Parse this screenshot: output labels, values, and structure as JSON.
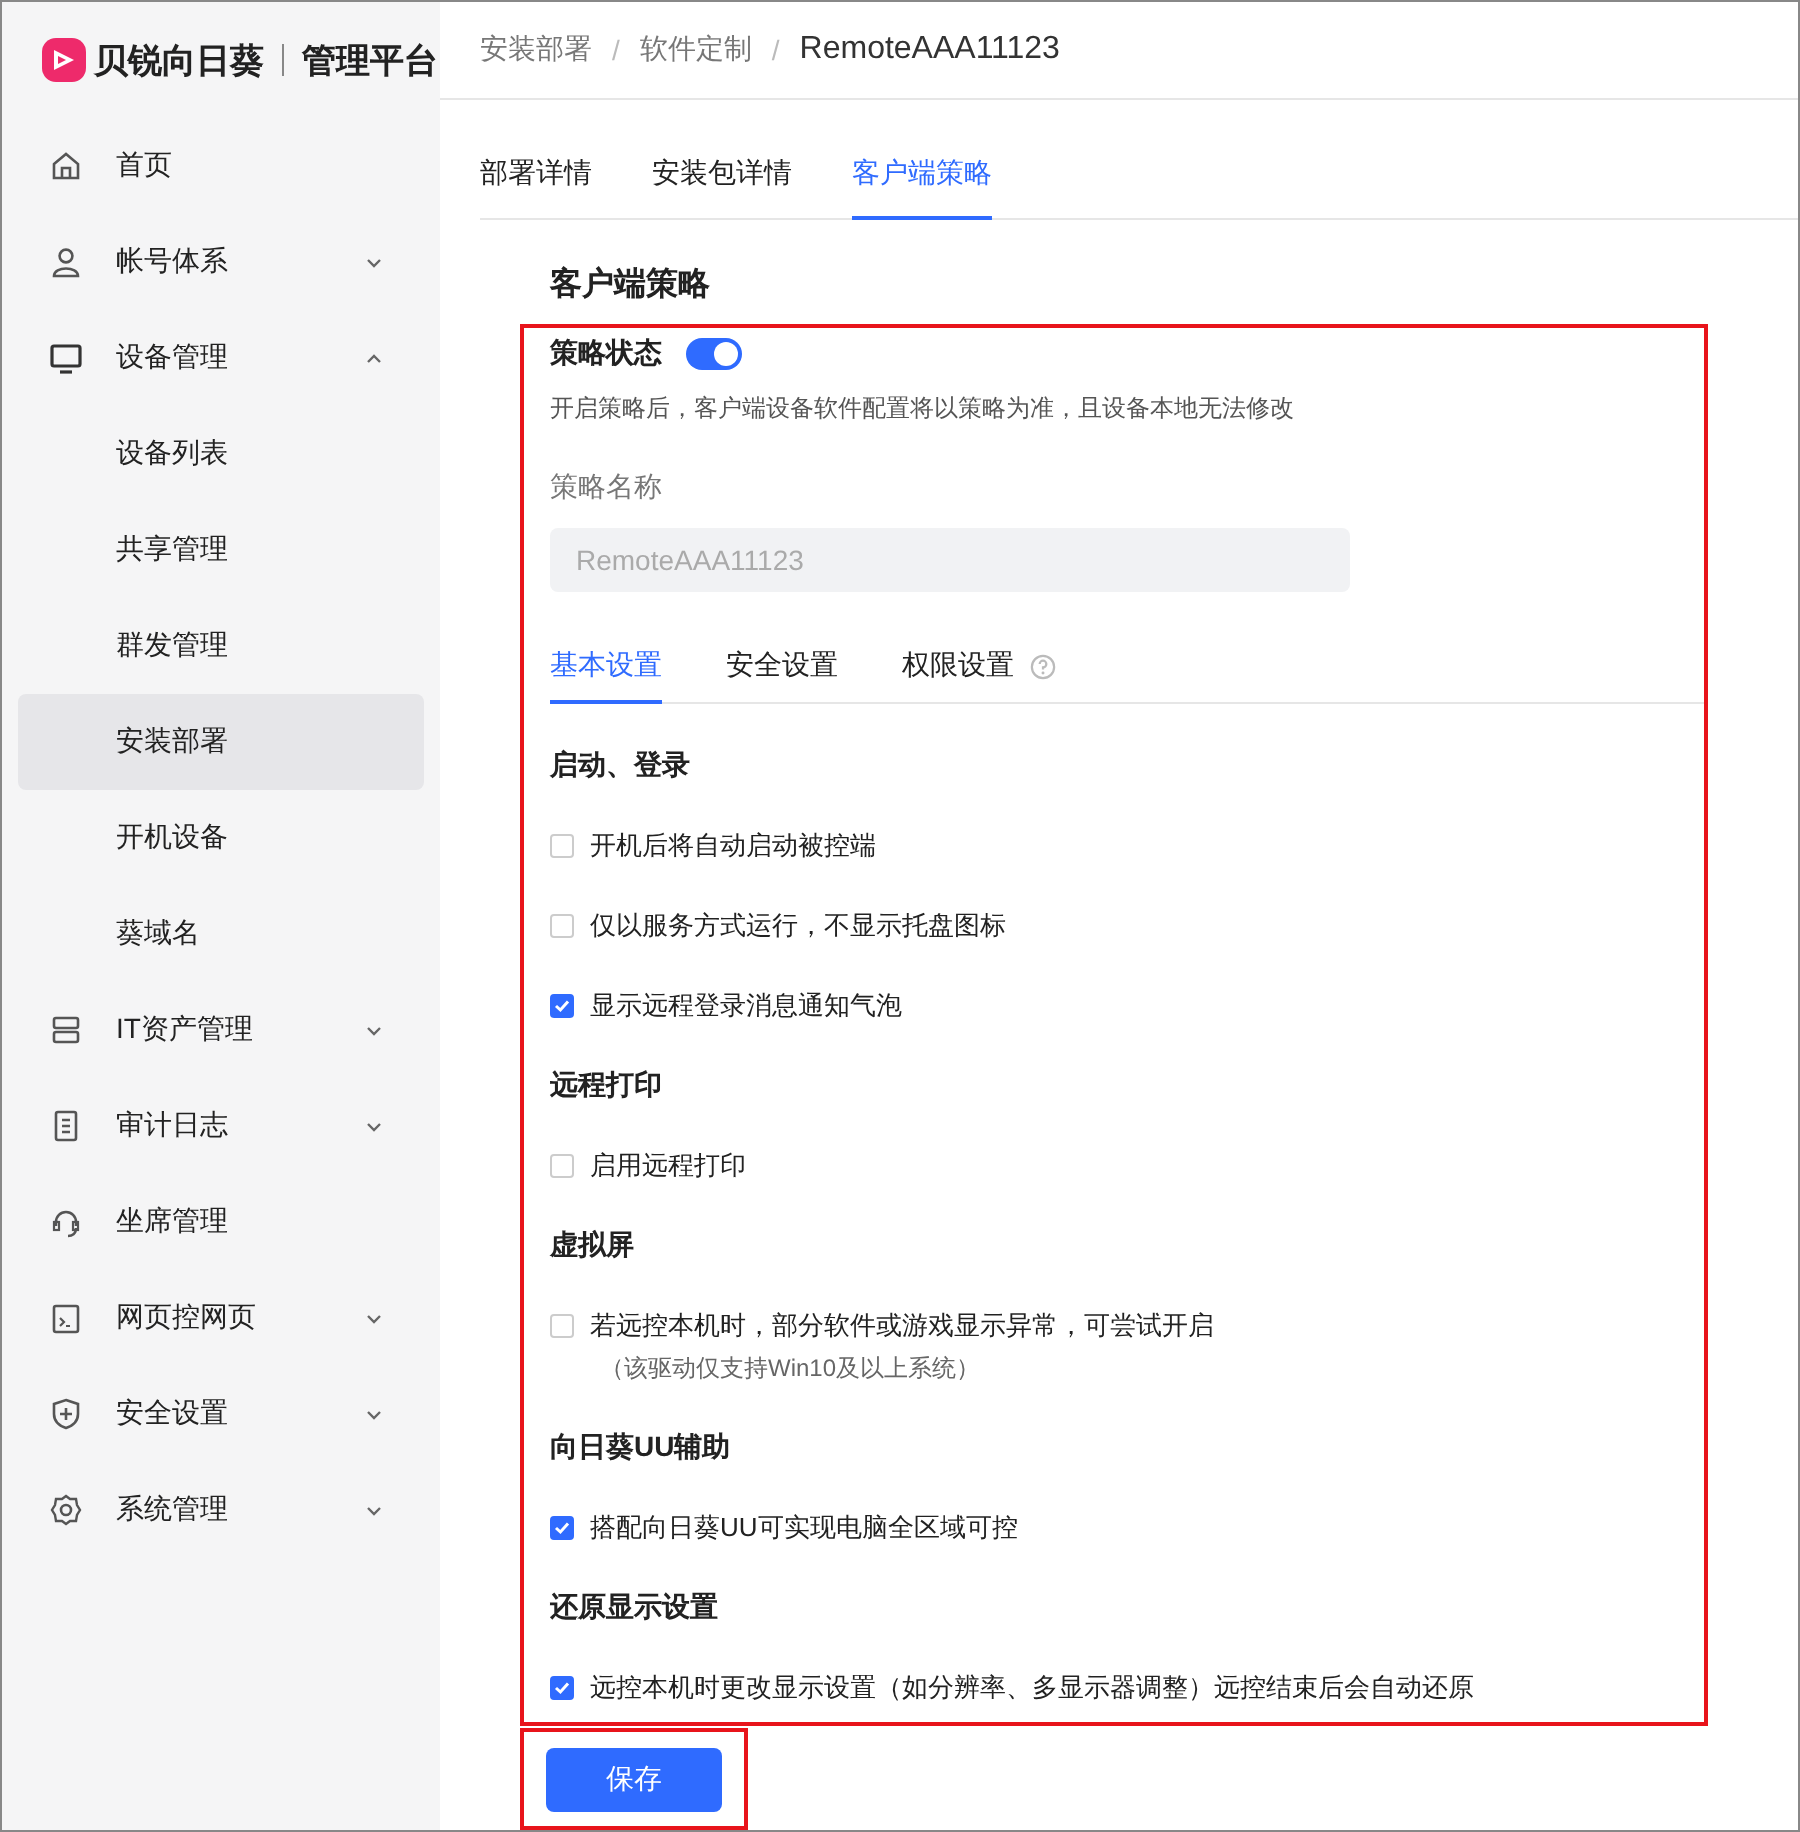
{
  "sidebar": {
    "logo": {
      "brand": "贝锐向日葵",
      "product": "管理平台"
    },
    "items": [
      {
        "label": "首页",
        "kind": "link"
      },
      {
        "label": "帐号体系",
        "kind": "group",
        "expanded": false
      },
      {
        "label": "设备管理",
        "kind": "group",
        "expanded": true,
        "children": [
          {
            "label": "设备列表",
            "selected": false
          },
          {
            "label": "共享管理",
            "selected": false
          },
          {
            "label": "群发管理",
            "selected": false
          },
          {
            "label": "安装部署",
            "selected": true
          },
          {
            "label": "开机设备",
            "selected": false
          },
          {
            "label": "葵域名",
            "selected": false
          }
        ]
      },
      {
        "label": "IT资产管理",
        "kind": "group",
        "expanded": false
      },
      {
        "label": "审计日志",
        "kind": "group",
        "expanded": false
      },
      {
        "label": "坐席管理",
        "kind": "link"
      },
      {
        "label": "网页控网页",
        "kind": "group",
        "expanded": false
      },
      {
        "label": "安全设置",
        "kind": "group",
        "expanded": false
      },
      {
        "label": "系统管理",
        "kind": "group",
        "expanded": false
      }
    ]
  },
  "breadcrumb": {
    "items": [
      "安装部署",
      "软件定制",
      "RemoteAAA11123"
    ],
    "separators": [
      "/",
      "/"
    ]
  },
  "tabs": [
    {
      "label": "部署详情",
      "selected": false
    },
    {
      "label": "安装包详情",
      "selected": false
    },
    {
      "label": "客户端策略",
      "selected": true
    }
  ],
  "policy": {
    "title": "客户端策略",
    "status_label": "策略状态",
    "status_on": true,
    "status_hint": "开启策略后，客户端设备软件配置将以策略为准，且设备本地无法修改",
    "name_label": "策略名称",
    "name_value": "RemoteAAA11123",
    "tabs": [
      {
        "label": "基本设置",
        "selected": true,
        "help": false
      },
      {
        "label": "安全设置",
        "selected": false,
        "help": false
      },
      {
        "label": "权限设置",
        "selected": false,
        "help": true
      }
    ],
    "sections": [
      {
        "title": "启动、登录",
        "options": [
          {
            "label": "开机后将自动启动被控端",
            "checked": false
          },
          {
            "label": "仅以服务方式运行，不显示托盘图标",
            "checked": false
          },
          {
            "label": "显示远程登录消息通知气泡",
            "checked": true
          }
        ]
      },
      {
        "title": "远程打印",
        "options": [
          {
            "label": "启用远程打印",
            "checked": false
          }
        ]
      },
      {
        "title": "虚拟屏",
        "options": [
          {
            "label": "若远控本机时，部分软件或游戏显示异常，可尝试开启",
            "checked": false,
            "note": "（该驱动仅支持Win10及以上系统）"
          }
        ]
      },
      {
        "title": "向日葵UU辅助",
        "options": [
          {
            "label": "搭配向日葵UU可实现电脑全区域可控",
            "checked": true
          }
        ]
      },
      {
        "title": "还原显示设置",
        "options": [
          {
            "label": "远控本机时更改显示设置（如分辨率、多显示器调整）远控结束后会自动还原",
            "checked": true
          }
        ]
      }
    ]
  },
  "save_button": "保存"
}
